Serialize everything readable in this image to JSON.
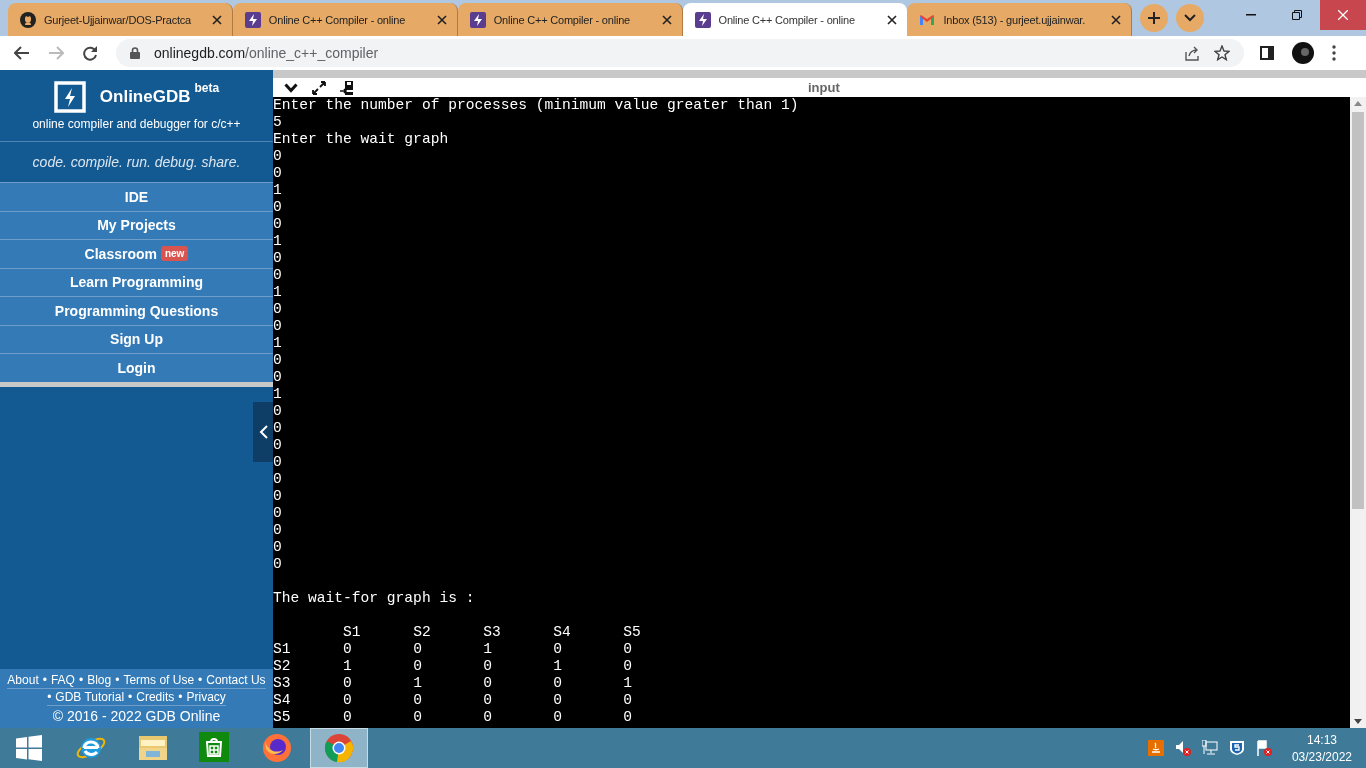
{
  "browser": {
    "tabs": [
      {
        "title": "Gurjeet-Ujjainwar/DOS-Practca",
        "kind": "github",
        "selected": false
      },
      {
        "title": "Online C++ Compiler - online",
        "kind": "bolt",
        "selected": false
      },
      {
        "title": "Online C++ Compiler - online",
        "kind": "bolt",
        "selected": false
      },
      {
        "title": "Online C++ Compiler - online",
        "kind": "bolt",
        "selected": true
      },
      {
        "title": "Inbox (513) - gurjeet.ujjainwar.",
        "kind": "mail",
        "selected": false
      }
    ],
    "address": {
      "host": "onlinegdb.com",
      "path": "/online_c++_compiler"
    }
  },
  "sidebar": {
    "brand": "OnlineGDB",
    "beta": "beta",
    "subtitle": "online compiler and debugger for c/c++",
    "tagline": "code. compile. run. debug. share.",
    "menu": [
      {
        "label": "IDE"
      },
      {
        "label": "My Projects"
      },
      {
        "label": "Classroom",
        "badge": "new"
      },
      {
        "label": "Learn Programming"
      },
      {
        "label": "Programming Questions"
      },
      {
        "label": "Sign Up"
      },
      {
        "label": "Login"
      }
    ],
    "footer_separator": "•",
    "footer_rows": [
      [
        "About",
        "FAQ",
        "Blog",
        "Terms of Use",
        "Contact Us"
      ],
      [
        "GDB Tutorial",
        "Credits",
        "Privacy"
      ]
    ],
    "copyright": "© 2016 - 2022 GDB Online"
  },
  "terminal": {
    "label": "input",
    "lines": [
      "Enter the number of processes (minimum value greater than 1)",
      "5",
      "Enter the wait graph",
      "0",
      "0",
      "1",
      "0",
      "0",
      "1",
      "0",
      "0",
      "1",
      "0",
      "0",
      "1",
      "0",
      "0",
      "1",
      "0",
      "0",
      "0",
      "0",
      "0",
      "0",
      "0",
      "0",
      "0",
      "0",
      {
        "kind": "blank"
      },
      "The wait-for graph is :",
      {
        "kind": "blank"
      },
      "\tS1\tS2\tS3\tS4\tS5",
      "S1\t0\t0\t1\t0\t0",
      "S2\t1\t0\t0\t1\t0",
      "S3\t0\t1\t0\t0\t1",
      "S4\t0\t0\t0\t0\t0",
      "S5\t0\t0\t0\t0\t0"
    ]
  },
  "taskbar": {
    "apps": [
      {
        "kind": "ie",
        "selected": false
      },
      {
        "kind": "explorer",
        "selected": false
      },
      {
        "kind": "store",
        "selected": false
      },
      {
        "kind": "firefox",
        "selected": false
      },
      {
        "kind": "chrome",
        "selected": true
      }
    ],
    "time": "14:13",
    "date": "03/23/2022"
  }
}
